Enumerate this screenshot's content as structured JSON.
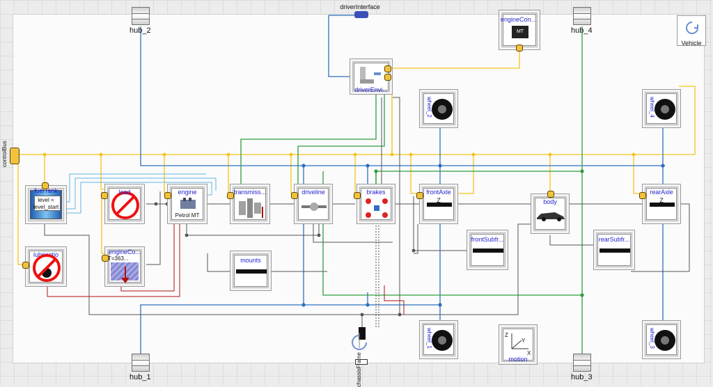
{
  "labels": {
    "driver_interface": "driverInterface",
    "control_bus": "controlBus",
    "chassis_frame": "chassisFrame",
    "vehicle": "Vehicle",
    "hub_1": "hub_1",
    "hub_2": "hub_2",
    "hub_3": "hub_3",
    "hub_4": "hub_4"
  },
  "blocks": {
    "engine_controller": "engineController",
    "engine_controller_chip": "MT",
    "driver_environment": "driverEnvi...",
    "fuel_tank": "fuelTank",
    "fuel_tank_text_1": "level =",
    "fuel_tank_text_2": "level_start",
    "lead": "lead",
    "engine": "engine",
    "engine_sub": "Petrol MT",
    "transmission": "transmiss...",
    "driveline": "driveline",
    "brakes": "brakes",
    "front_axle": "frontAxle",
    "front_axle_z": "Z",
    "body": "body",
    "rear_axle": "rearAxle",
    "rear_axle_z": "Z",
    "lubrication": "lubricatio",
    "engine_cooling": "engineCo...",
    "engine_cooling_text": "T=363...",
    "mounts": "mounts",
    "front_subframe": "frontSubfr...",
    "rear_subframe": "rearSubfr...",
    "wheel_1": "wheel_1",
    "wheel_2": "wheel_2",
    "wheel_3": "wheel_3",
    "wheel_4": "wheel_4",
    "motion": "motion",
    "motion_z": "Z",
    "motion_x": "X",
    "motion_y": "Y"
  },
  "colors": {
    "signal": "#f7c21a",
    "mechanical": "#2e6fc0",
    "rotational": "#555555",
    "electrical": "#2f9e3f",
    "thermal": "#b01010",
    "fluid": "#5fb6e6",
    "label": "#1f1fd0"
  }
}
